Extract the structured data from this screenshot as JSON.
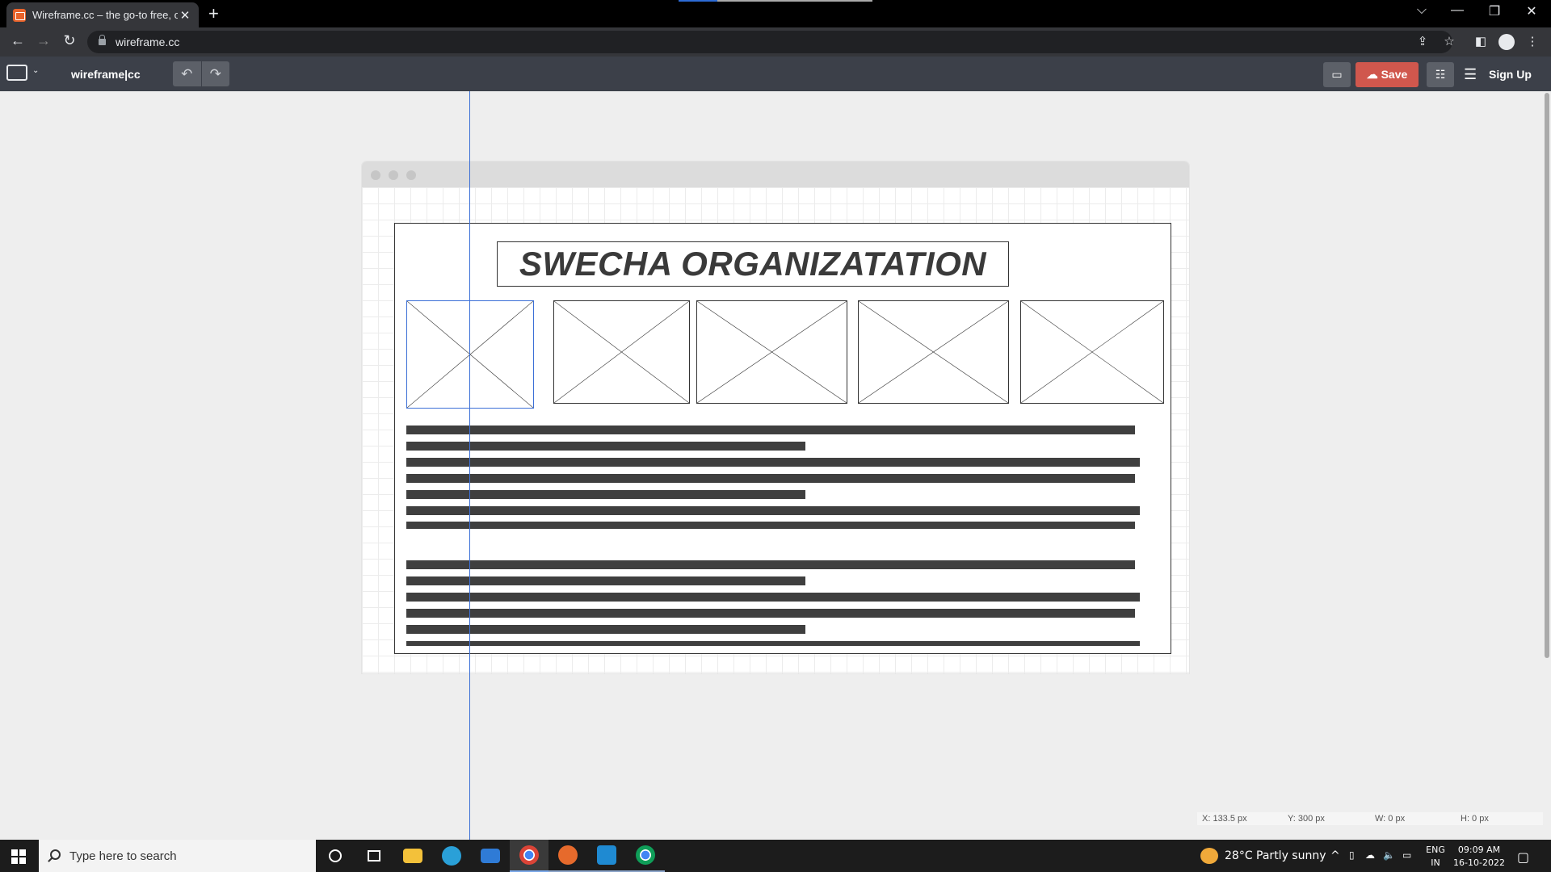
{
  "browser": {
    "tab_title": "Wireframe.cc – the go-to free, on",
    "tab_close": "✕",
    "new_tab": "+",
    "url": "wireframe.cc",
    "window_controls": {
      "tabs_menu": "⌵",
      "minimize": "—",
      "restore": "❐",
      "close": "✕"
    },
    "nav": {
      "back": "←",
      "forward": "→",
      "reload": "↻"
    },
    "icons": {
      "share": "⇪",
      "bookmark": "☆",
      "sidepanel": "◧",
      "menu": "⋮"
    }
  },
  "app": {
    "logo": "wireframe|cc",
    "page_caret": "⌄",
    "undo": "↶",
    "redo": "↷",
    "comment_icon": "▭",
    "save_label": "☁ Save",
    "settings_icon": "☷",
    "menu_icon": "☰",
    "signup_label": "Sign Up",
    "accent_color": "#d0574d"
  },
  "wireframe": {
    "heading": "SWECHA ORGANIZATATION",
    "image_placeholders": 5,
    "selected_placeholder": 1,
    "text_line_groups": 2
  },
  "status": {
    "x": "X: 133.5 px",
    "y": "Y: 300 px",
    "w": "W: 0 px",
    "h": "H: 0 px"
  },
  "taskbar": {
    "search_placeholder": "Type here to search",
    "weather": "28°C  Partly sunny",
    "lang_top": "ENG",
    "lang_bottom": "IN",
    "time": "09:09 AM",
    "date": "16-10-2022",
    "tray_chevron": "^",
    "notification_icon": "▢"
  }
}
